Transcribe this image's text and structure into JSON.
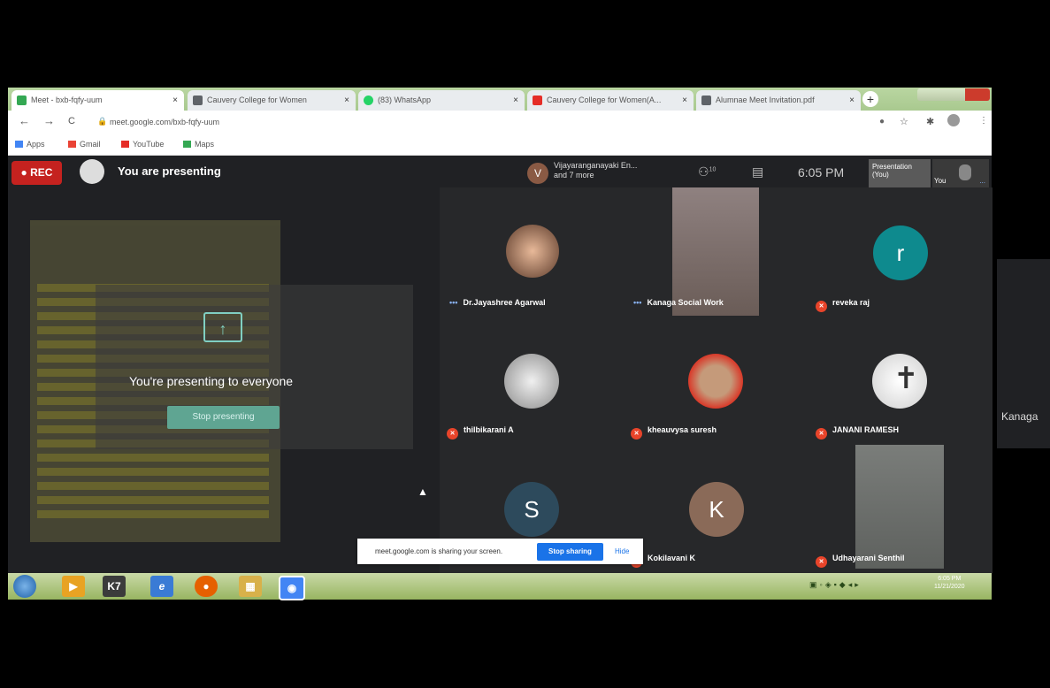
{
  "browser": {
    "tabs": [
      {
        "title": "Meet - bxb-fqfy-uum",
        "fav_color": "#34a853",
        "x": "×"
      },
      {
        "title": "Cauvery College for Women",
        "fav_color": "#5f6368",
        "x": "×"
      },
      {
        "title": "(83) WhatsApp",
        "fav_color": "#25d366",
        "x": "×"
      },
      {
        "title": "Cauvery College for Women(A...",
        "fav_color": "#e52d27",
        "x": "×"
      },
      {
        "title": "Alumnae Meet Invitation.pdf",
        "fav_color": "#5f6368",
        "x": "×"
      }
    ],
    "new_tab": "+",
    "nav": {
      "back": "←",
      "forward": "→",
      "reload": "C"
    },
    "url": "meet.google.com/bxb-fqfy-uum",
    "lock": "🔒",
    "bookmarks": [
      {
        "label": "Apps",
        "color": "#4285f4"
      },
      {
        "label": "Gmail",
        "color": "#ea4335"
      },
      {
        "label": "YouTube",
        "color": "#e52d27"
      },
      {
        "label": "Maps",
        "color": "#34a853"
      }
    ]
  },
  "meet": {
    "rec_label": "● REC",
    "presenting_status": "You are presenting",
    "participants_badge_letter": "V",
    "participants_line1": "Vijayaranganayaki En...",
    "participants_line2": "and 7 more",
    "people_icon": "⚇",
    "people_count": "10",
    "chat_icon": "▤",
    "time": "6:05 PM",
    "presentation_thumb_label": "Presentation (You)",
    "you_thumb_label": "You",
    "more_dots": "..."
  },
  "presentation": {
    "upload_glyph": "↑",
    "message": "You're presenting to everyone",
    "stop_button": "Stop presenting",
    "cursor_glyph": "▲"
  },
  "participants": [
    {
      "name": "Dr.Jayashree Agarwal",
      "indicator": "dots"
    },
    {
      "name": "Kanaga Social Work",
      "indicator": "dots"
    },
    {
      "name": "reveka raj",
      "letter": "r",
      "color": "#0e8a8e",
      "indicator": "mic"
    },
    {
      "name": "thilbikarani A",
      "indicator": "mic"
    },
    {
      "name": "kheauvysa suresh",
      "indicator": "mic"
    },
    {
      "name": "JANANI RAMESH",
      "indicator": "mic"
    },
    {
      "name": "",
      "letter": "S",
      "color": "#2d4a5c",
      "indicator": ""
    },
    {
      "name": "Kokilavani K",
      "letter": "K",
      "color": "#8a6a58",
      "indicator": "mic"
    },
    {
      "name": "Udhayarani Senthil",
      "indicator": "mic"
    }
  ],
  "side_tile": {
    "name": "Kanaga"
  },
  "share_bar": {
    "text": "meet.google.com is sharing your screen.",
    "stop_button": "Stop sharing",
    "hide_link": "Hide"
  },
  "taskbar": {
    "items": [
      {
        "label": "▶",
        "color": "#e8a323"
      },
      {
        "label": "K7",
        "color": "#3b3b3b"
      },
      {
        "label": "e",
        "color": "#3a7bd5"
      },
      {
        "label": "●",
        "color": "#e66000"
      },
      {
        "label": "▦",
        "color": "#d8b14a"
      },
      {
        "label": "◉",
        "color": "#4285f4"
      }
    ],
    "tray_time": "6:05 PM",
    "tray_date": "11/21/2020"
  },
  "colors": {
    "accent_blue": "#1a73e8",
    "rec_red": "#c5221f",
    "meet_bg": "#202124"
  }
}
